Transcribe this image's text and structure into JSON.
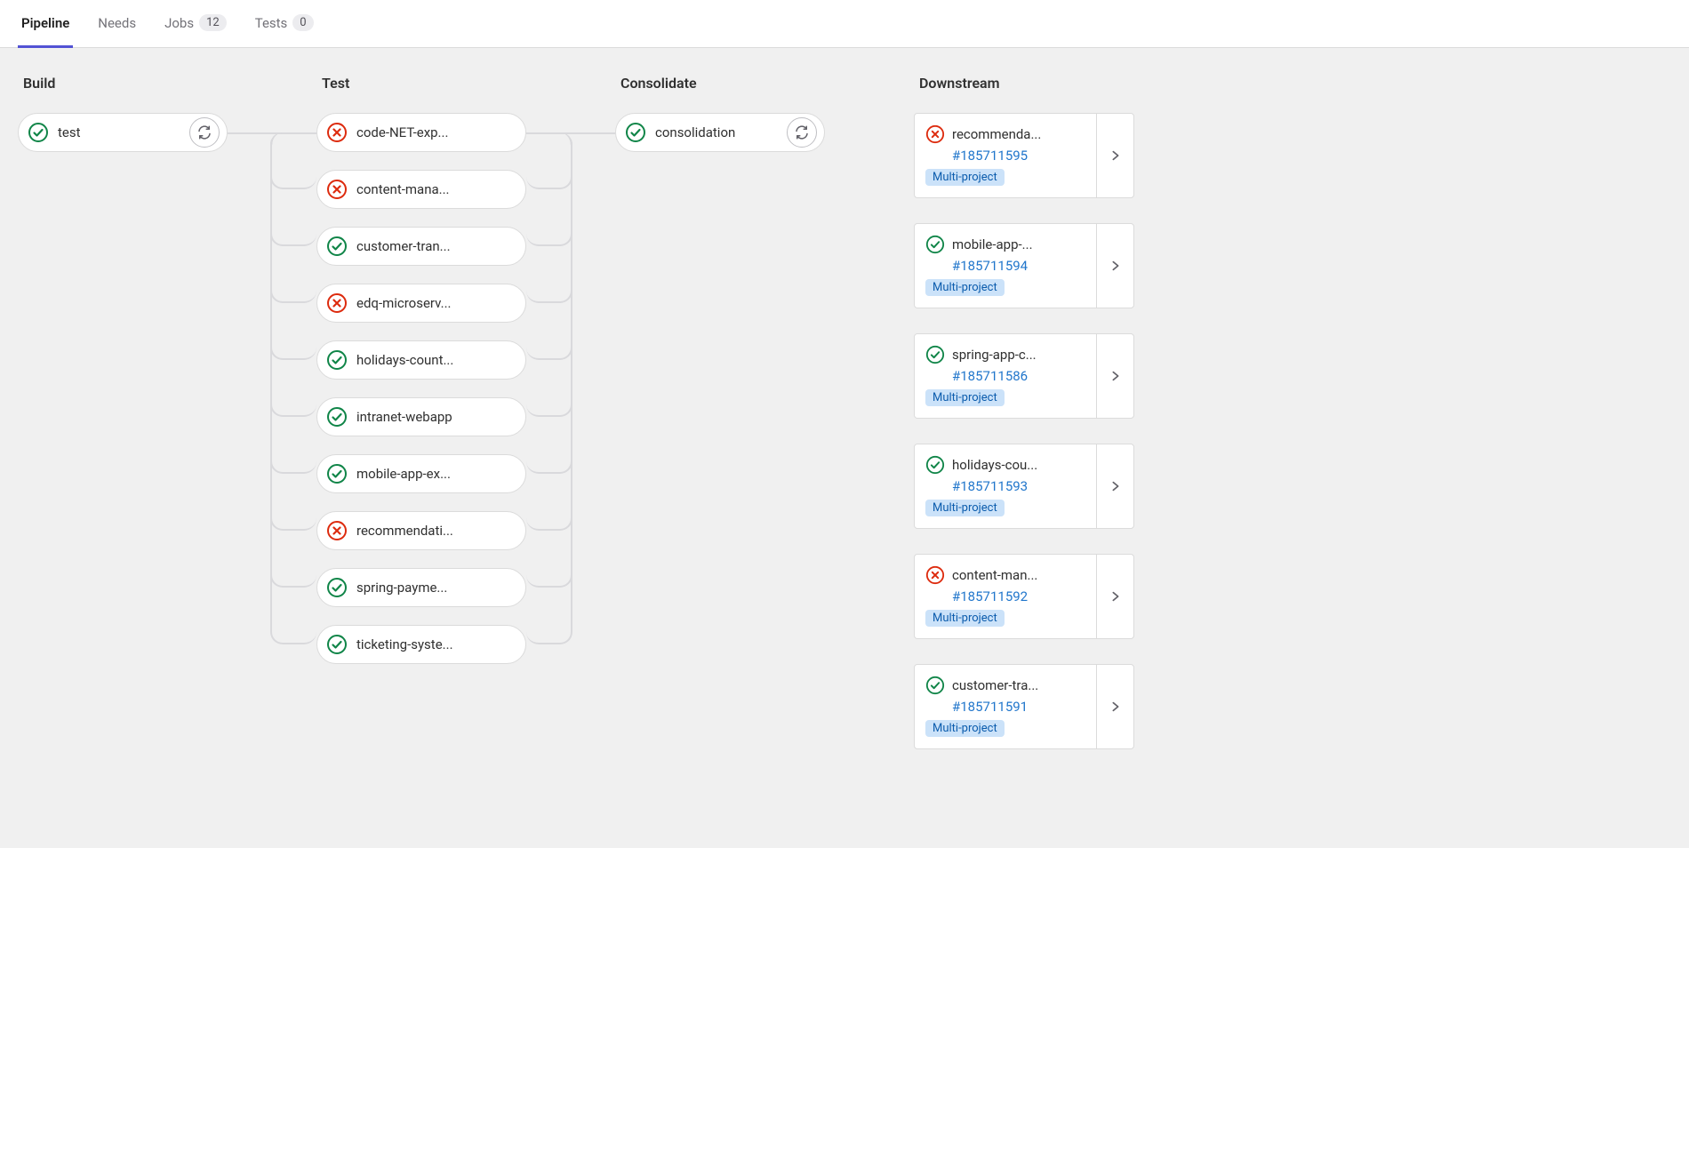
{
  "tabs": [
    {
      "label": "Pipeline",
      "active": true
    },
    {
      "label": "Needs",
      "active": false
    },
    {
      "label": "Jobs",
      "active": false,
      "badge": "12"
    },
    {
      "label": "Tests",
      "active": false,
      "badge": "0"
    }
  ],
  "stages": [
    {
      "title": "Build",
      "jobs": [
        {
          "label": "test",
          "status": "success",
          "retry": true
        }
      ]
    },
    {
      "title": "Test",
      "jobs": [
        {
          "label": "code-NET-exp...",
          "status": "failed"
        },
        {
          "label": "content-mana...",
          "status": "failed"
        },
        {
          "label": "customer-tran...",
          "status": "success"
        },
        {
          "label": "edq-microserv...",
          "status": "failed"
        },
        {
          "label": "holidays-count...",
          "status": "success"
        },
        {
          "label": "intranet-webapp",
          "status": "success"
        },
        {
          "label": "mobile-app-ex...",
          "status": "success"
        },
        {
          "label": "recommendati...",
          "status": "failed"
        },
        {
          "label": "spring-payme...",
          "status": "success"
        },
        {
          "label": "ticketing-syste...",
          "status": "success"
        }
      ]
    },
    {
      "title": "Consolidate",
      "jobs": [
        {
          "label": "consolidation",
          "status": "success",
          "retry": true
        }
      ]
    }
  ],
  "downstream": {
    "title": "Downstream",
    "items": [
      {
        "title": "recommenda...",
        "status": "failed",
        "id": "#185711595",
        "badge": "Multi-project"
      },
      {
        "title": "mobile-app-...",
        "status": "success",
        "id": "#185711594",
        "badge": "Multi-project"
      },
      {
        "title": "spring-app-c...",
        "status": "success",
        "id": "#185711586",
        "badge": "Multi-project"
      },
      {
        "title": "holidays-cou...",
        "status": "success",
        "id": "#185711593",
        "badge": "Multi-project"
      },
      {
        "title": "content-man...",
        "status": "failed",
        "id": "#185711592",
        "badge": "Multi-project"
      },
      {
        "title": "customer-tra...",
        "status": "success",
        "id": "#185711591",
        "badge": "Multi-project"
      }
    ]
  }
}
